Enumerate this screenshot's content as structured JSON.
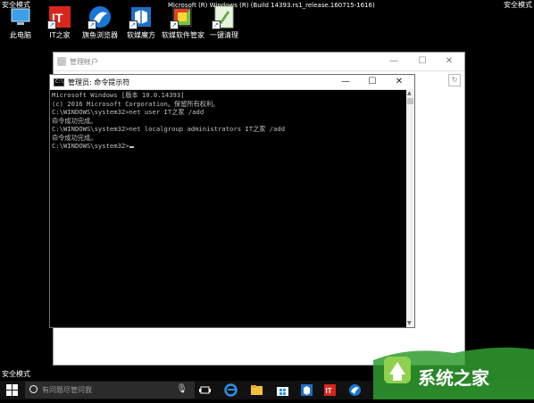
{
  "desktop": {
    "safe_mode_top_left": "安全模式",
    "safe_mode_top_right": "安全模式",
    "safe_mode_bottom_left": "安全模式",
    "build_text": "Microsoft (R) Windows (R) (Build 14393.rs1_release.160715-1616)",
    "icons": [
      {
        "label": "此电脑",
        "icon": "this-pc-icon"
      },
      {
        "label": "IT之家",
        "icon": "ithome-icon"
      },
      {
        "label": "旗鱼浏览器",
        "icon": "browser-icon"
      },
      {
        "label": "软媒魔方",
        "icon": "rubik-cube-icon"
      },
      {
        "label": "软媒软件管家",
        "icon": "software-manager-icon"
      },
      {
        "label": "一键清理",
        "icon": "cleaner-icon"
      }
    ]
  },
  "bg_window": {
    "title": "管理帐户"
  },
  "cmd_window": {
    "title": "管理员: 命令提示符",
    "lines": [
      "Microsoft Windows [版本 10.0.14393]",
      "(c) 2016 Microsoft Corporation。保留所有权利。",
      "",
      "C:\\WINDOWS\\system32>net user IT之家 /add",
      "命令成功完成。",
      "",
      "",
      "C:\\WINDOWS\\system32>net localgroup administrators IT之家 /add",
      "命令成功完成。",
      "",
      "",
      "C:\\WINDOWS\\system32>"
    ]
  },
  "taskbar": {
    "search_placeholder": "有问题尽管问我",
    "items": [
      "start-icon",
      "microphone-icon",
      "task-view-icon",
      "edge-icon",
      "file-explorer-icon",
      "store-icon",
      "cube-app-icon",
      "ithome-app-icon",
      "browser-app-icon"
    ]
  },
  "watermark": {
    "text": "系统之家"
  }
}
